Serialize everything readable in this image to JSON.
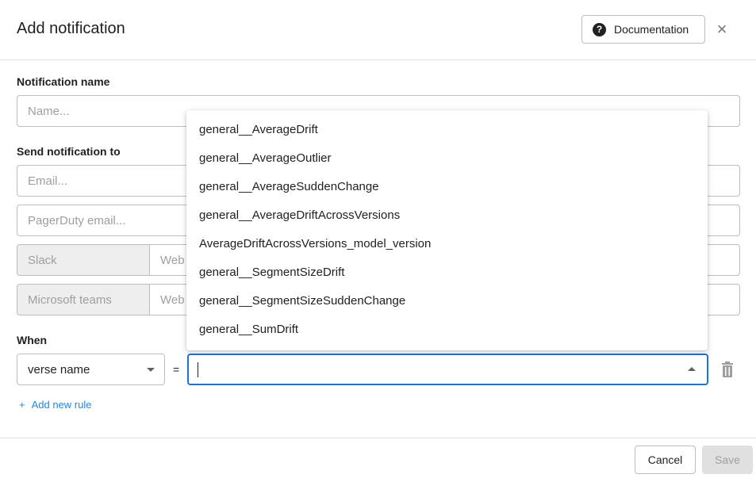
{
  "header": {
    "title": "Add notification",
    "documentation_label": "Documentation",
    "help_glyph": "?",
    "close_glyph": "×"
  },
  "form": {
    "notification_name": {
      "label": "Notification name",
      "placeholder": "Name..."
    },
    "send_to": {
      "label": "Send notification to",
      "email_placeholder": "Email...",
      "pagerduty_placeholder": "PagerDuty email...",
      "slack_label": "Slack",
      "slack_webhook_placeholder": "Web",
      "teams_label": "Microsoft teams",
      "teams_webhook_placeholder": "Web"
    },
    "when": {
      "label": "When",
      "field_selected": "verse name",
      "operator": "=",
      "value": ""
    },
    "add_rule_label": "Add new rule",
    "add_rule_glyph": "+"
  },
  "dropdown": {
    "options": [
      "general__AverageDrift",
      "general__AverageOutlier",
      "general__AverageSuddenChange",
      "general__AverageDriftAcrossVersions",
      "AverageDriftAcrossVersions_model_version",
      "general__SegmentSizeDrift",
      "general__SegmentSizeSuddenChange",
      "general__SumDrift"
    ]
  },
  "footer": {
    "cancel_label": "Cancel",
    "save_label": "Save"
  },
  "colors": {
    "accent": "#1976d2",
    "link": "#1e88e5",
    "disabled_bg": "#e0e0e0"
  }
}
